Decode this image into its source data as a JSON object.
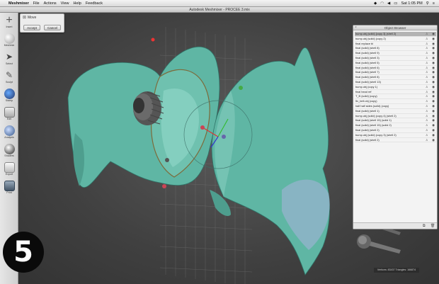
{
  "menubar": {
    "app_name": "Meshmixer",
    "items": [
      "File",
      "Actions",
      "View",
      "Help",
      "Feedback"
    ],
    "clock": "Sat 1:05 PM"
  },
  "window": {
    "title": "Autodesk Meshmixer - PROCEE 3.mix"
  },
  "toolbar": {
    "tools": [
      {
        "label": "Insert",
        "icon": "plus-icon"
      },
      {
        "label": "Meshmix",
        "icon": "sphere-icon"
      },
      {
        "label": "Select",
        "icon": "cursor-icon"
      },
      {
        "label": "Sculpt",
        "icon": "brush-icon"
      },
      {
        "label": "Stamp",
        "icon": "stamp-icon"
      },
      {
        "label": "Edit",
        "icon": "edit-icon"
      },
      {
        "label": "Analysis",
        "icon": "globe-icon"
      },
      {
        "label": "Shaders",
        "icon": "shader-icon"
      },
      {
        "label": "Export",
        "icon": "export-icon"
      },
      {
        "label": "Print",
        "icon": "print-icon"
      }
    ]
  },
  "accept_panel": {
    "title": "Move",
    "accept_label": "Accept",
    "cancel_label": "Cancel"
  },
  "object_browser": {
    "title": "Object Browser",
    "rows": [
      "bump.obj (solid) [copy 3] (shell 2)",
      "bump.obj (solid) (copy 2)",
      "final replace bl",
      "final (solid) (shell 8)",
      "final (solid) (shell 9)",
      "final (solid) (shell 3)",
      "final (solid) (shell 5)",
      "final (solid) (shell 6)",
      "final (solid) (shell 7)",
      "final (solid) (shell 8)",
      "final (solid) (shell 13)",
      "bump.obj (copy 1)",
      "final head ref",
      "T_B (solid) (copy)",
      "5v_bell.obj (copy)",
      "half half sides (solid) (copy)",
      "final (solid) (shell 1)",
      "bump.obj (solid) (copy 4) (shell 2)",
      "final (solid) (shell 15) (solid 1)",
      "final (solid) (shell 15) (solid 2)",
      "final (solid) (shell 2)",
      "bump.obj (solid) (copy 3) (shell 2)",
      "final (solid) (shell 2)"
    ]
  },
  "status_text": "Vertices: 83437 Triangles: 166874",
  "step_badge": "5",
  "colors": {
    "model": "#5fb6a4",
    "model_shadow": "#2f7468",
    "viewport_bg": "#404040",
    "selected_row": "#b3b3b3"
  }
}
